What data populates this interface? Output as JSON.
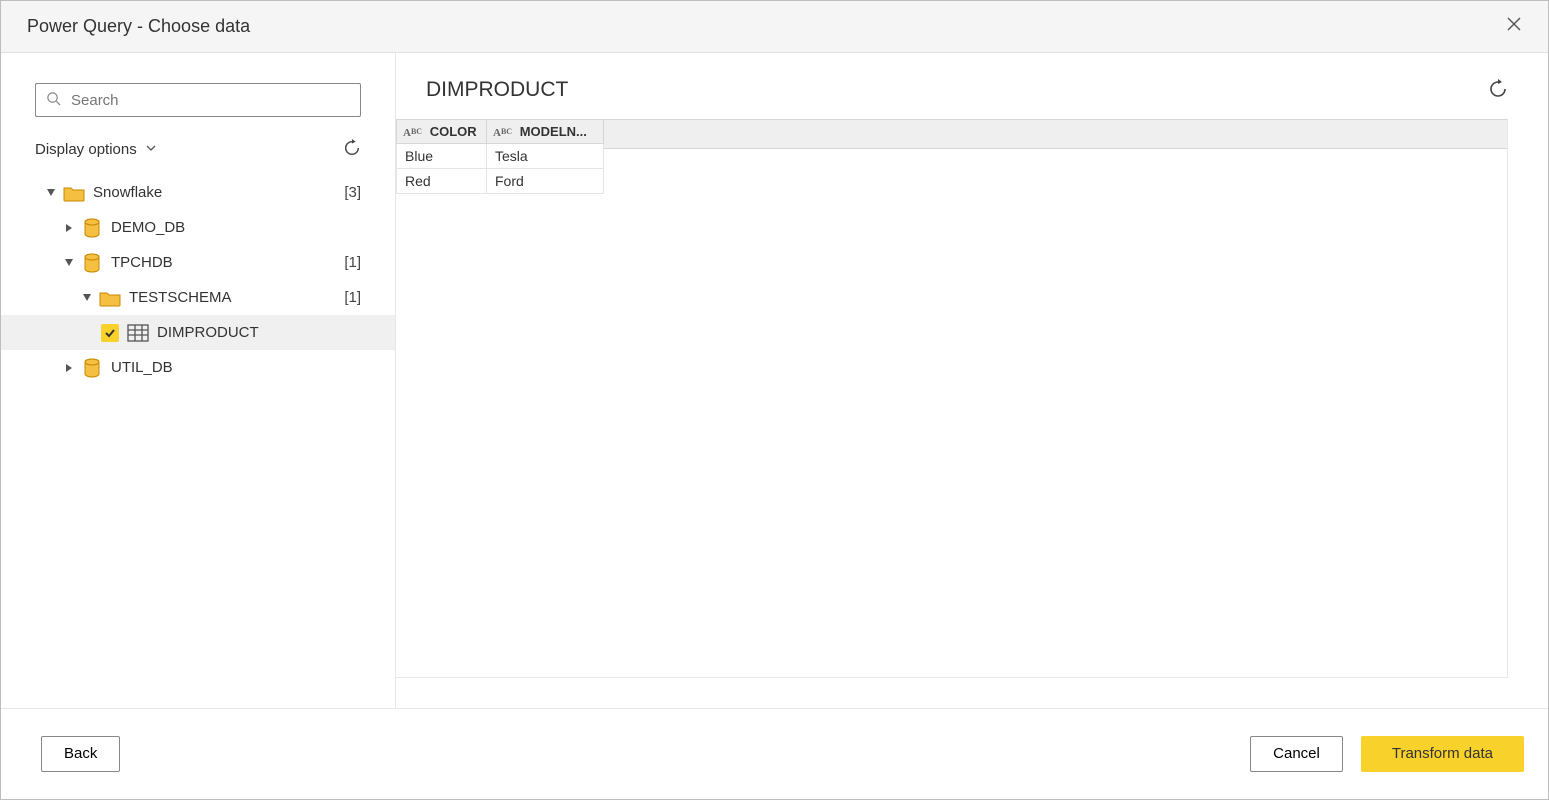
{
  "window": {
    "title": "Power Query - Choose data"
  },
  "search": {
    "placeholder": "Search"
  },
  "display": {
    "label": "Display options"
  },
  "tree": {
    "root": {
      "label": "Snowflake",
      "count": "[3]"
    },
    "demo_db": {
      "label": "DEMO_DB"
    },
    "tpchdb": {
      "label": "TPCHDB",
      "count": "[1]"
    },
    "testschema": {
      "label": "TESTSCHEMA",
      "count": "[1]"
    },
    "dimproduct": {
      "label": "DIMPRODUCT"
    },
    "util_db": {
      "label": "UTIL_DB"
    }
  },
  "preview": {
    "title": "DIMPRODUCT",
    "columns": {
      "col1": "COLOR",
      "col2": "MODELN..."
    },
    "rows": [
      {
        "c1": "Blue",
        "c2": "Tesla"
      },
      {
        "c1": "Red",
        "c2": "Ford"
      }
    ]
  },
  "buttons": {
    "back": "Back",
    "cancel": "Cancel",
    "transform": "Transform data"
  }
}
